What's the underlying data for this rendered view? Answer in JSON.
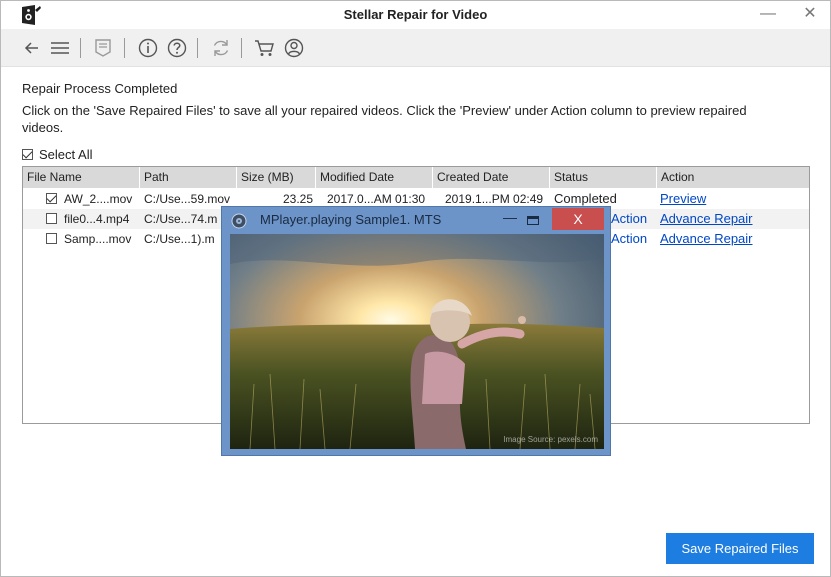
{
  "window": {
    "title": "Stellar Repair for Video",
    "minimize": "—",
    "close": "✕"
  },
  "toolbar": {
    "icons": [
      "back-arrow-icon",
      "hamburger-menu-icon",
      "log-report-icon",
      "info-icon",
      "help-icon",
      "refresh-icon",
      "cart-icon",
      "account-icon"
    ]
  },
  "content": {
    "heading": "Repair Process Completed",
    "instructions": "Click on the 'Save Repaired Files' to save all your repaired videos. Click the 'Preview' under Action column to preview repaired videos.",
    "select_all_label": "Select All",
    "select_all_checked": true
  },
  "table": {
    "columns": [
      "File Name",
      "Path",
      "Size (MB)",
      "Modified Date",
      "Created Date",
      "Status",
      "Action"
    ],
    "rows": [
      {
        "checked": true,
        "name": "AW_2....mov",
        "path": "C:/Use...59.mov",
        "size": "23.25",
        "modified": "2017.0...AM 01:30",
        "created": "2019.1...PM 02:49",
        "status": "Completed",
        "action": "Preview"
      },
      {
        "checked": false,
        "name": "file0...4.mp4",
        "path": "C:/Use...74.m",
        "size": "",
        "modified": "",
        "created": "",
        "status": "Action",
        "action": "Advance Repair"
      },
      {
        "checked": false,
        "name": "Samp....mov",
        "path": "C:/Use...1).m",
        "size": "",
        "modified": "",
        "created": "",
        "status": "Action",
        "action": "Advance Repair"
      }
    ]
  },
  "player": {
    "title": "MPlayer.playing Sample1. MTS",
    "close_label": "X",
    "minimize_label": "—",
    "watermark": "Image Source: pexels.com"
  },
  "footer": {
    "save_button": "Save Repaired Files"
  },
  "colors": {
    "accent": "#1e7de0",
    "link": "#0047c6",
    "player_frame": "#6c94c9",
    "player_close": "#c94e4e"
  }
}
